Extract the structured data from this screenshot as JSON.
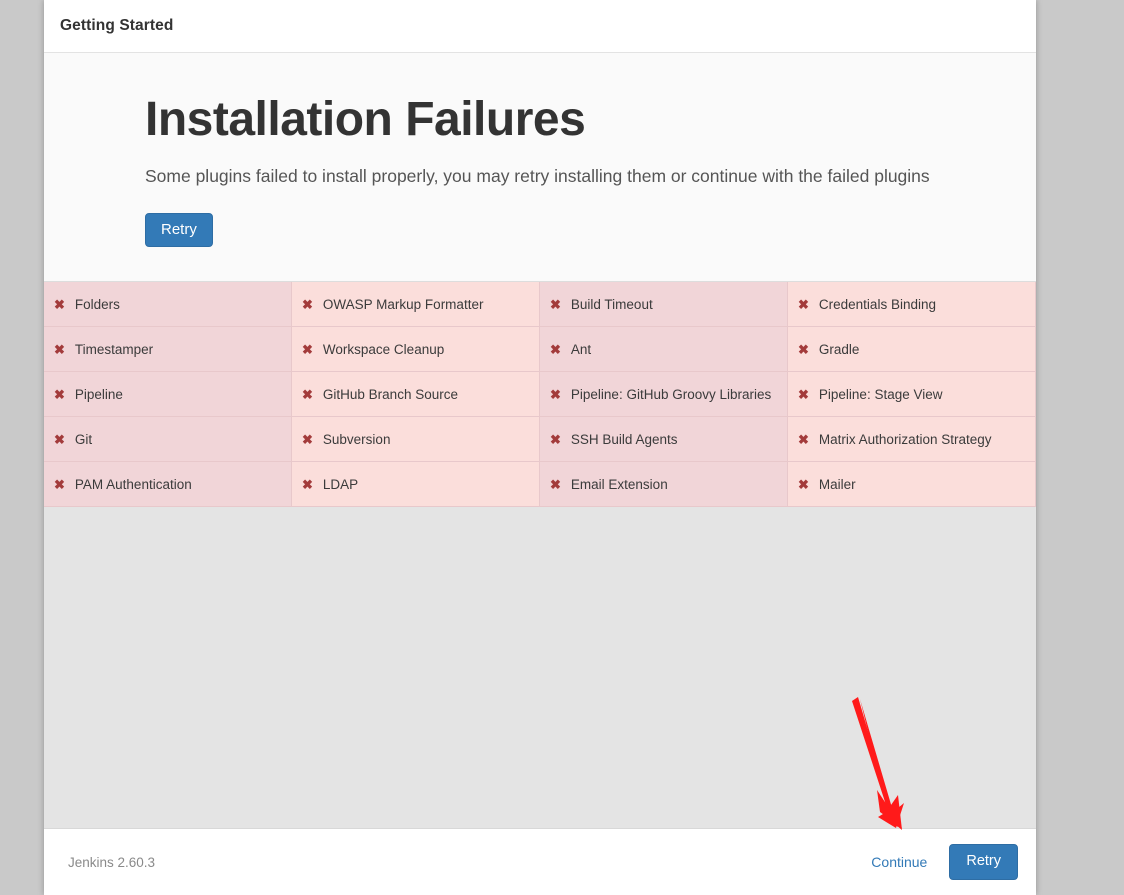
{
  "header": {
    "title": "Getting Started"
  },
  "hero": {
    "heading": "Installation Failures",
    "subtitle": "Some plugins failed to install properly, you may retry installing them or continue with the failed plugins",
    "retry_label": "Retry"
  },
  "failure_grid": {
    "fail_icon": "✖",
    "columns": 4,
    "plugins": [
      "Folders",
      "OWASP Markup Formatter",
      "Build Timeout",
      "Credentials Binding",
      "Timestamper",
      "Workspace Cleanup",
      "Ant",
      "Gradle",
      "Pipeline",
      "GitHub Branch Source",
      "Pipeline: GitHub Groovy Libraries",
      "Pipeline: Stage View",
      "Git",
      "Subversion",
      "SSH Build Agents",
      "Matrix Authorization Strategy",
      "PAM Authentication",
      "LDAP",
      "Email Extension",
      "Mailer"
    ]
  },
  "footer": {
    "version": "Jenkins 2.60.3",
    "continue_label": "Continue",
    "retry_label": "Retry"
  },
  "colors": {
    "accent": "#337ab7",
    "fail_icon": "#a33b3b",
    "cell_odd": "#f1d5d8",
    "cell_even": "#fbdedb",
    "annotation_arrow": "#ff1a1a",
    "page_background": "#c9c9c9"
  }
}
